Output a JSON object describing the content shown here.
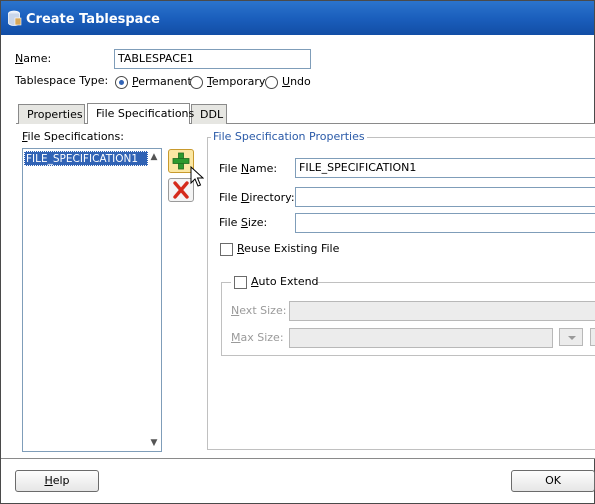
{
  "window": {
    "title": "Create Tablespace",
    "titlebar_color": "#1b5fbd"
  },
  "name_field": {
    "label_prefix": "",
    "label_hot": "N",
    "label_rest": "ame:",
    "value": "TABLESPACE1"
  },
  "tablespace_type": {
    "label": "Tablespace Type:",
    "options": [
      {
        "hot": "P",
        "rest": "ermanent",
        "selected": true
      },
      {
        "hot": "T",
        "rest": "emporary",
        "selected": false
      },
      {
        "hot": "U",
        "rest": "ndo",
        "selected": false
      }
    ]
  },
  "tabs": [
    {
      "label": "Properties",
      "active": false
    },
    {
      "label": "File Specifications",
      "active": true
    },
    {
      "label": "DDL",
      "active": false
    }
  ],
  "file_specs_list": {
    "label_hot": "F",
    "label_rest": "ile Specifications:",
    "items": [
      "FILE_SPECIFICATION1"
    ]
  },
  "list_buttons": {
    "add_icon": "add-icon",
    "remove_icon": "remove-icon"
  },
  "properties_group": {
    "title": "File Specification Properties",
    "file_name": {
      "label_pre": "File ",
      "label_hot": "N",
      "label_post": "ame:",
      "value": "FILE_SPECIFICATION1"
    },
    "file_directory": {
      "label_pre": "File ",
      "label_hot": "D",
      "label_post": "irectory:",
      "value": ""
    },
    "file_size": {
      "label_pre": "File ",
      "label_hot": "S",
      "label_post": "ize:",
      "value": ""
    },
    "reuse_existing": {
      "label_hot": "R",
      "label_rest": "euse Existing File",
      "checked": false
    },
    "auto_extend": {
      "label_hot": "A",
      "label_rest": "uto Extend",
      "checked": false,
      "next_size": {
        "label_hot": "N",
        "label_rest": "ext Size:",
        "value": ""
      },
      "max_size": {
        "label_hot": "M",
        "label_rest": "ax Size:",
        "value": ""
      }
    }
  },
  "footer": {
    "help": {
      "label_hot": "H",
      "label_rest": "elp"
    },
    "ok": {
      "label": "OK"
    }
  }
}
